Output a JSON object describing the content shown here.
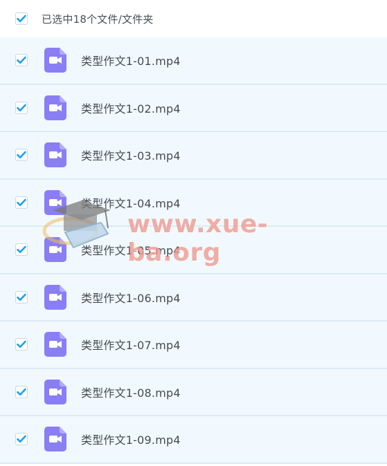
{
  "header": {
    "selected_label": "已选中18个文件/文件夹",
    "checked": true
  },
  "files": [
    {
      "name": "类型作文1-01.mp4",
      "checked": true
    },
    {
      "name": "类型作文1-02.mp4",
      "checked": true
    },
    {
      "name": "类型作文1-03.mp4",
      "checked": true
    },
    {
      "name": "类型作文1-04.mp4",
      "checked": true
    },
    {
      "name": "类型作文1-05.mp4",
      "checked": true
    },
    {
      "name": "类型作文1-06.mp4",
      "checked": true
    },
    {
      "name": "类型作文1-07.mp4",
      "checked": true
    },
    {
      "name": "类型作文1-08.mp4",
      "checked": true
    },
    {
      "name": "类型作文1-09.mp4",
      "checked": true
    }
  ],
  "watermark": {
    "text": "www.xue-ba.org",
    "icon": "graduation-cap-logo"
  },
  "colors": {
    "checkbox_check": "#1f9ff2",
    "file_icon": "#8a7ef5",
    "row_background": "#f1f9fe",
    "row_divider": "#dbeaf6",
    "watermark_text": "#e86c5a"
  },
  "icons": {
    "checkbox": "checkmark-icon",
    "file": "video-file-icon"
  }
}
